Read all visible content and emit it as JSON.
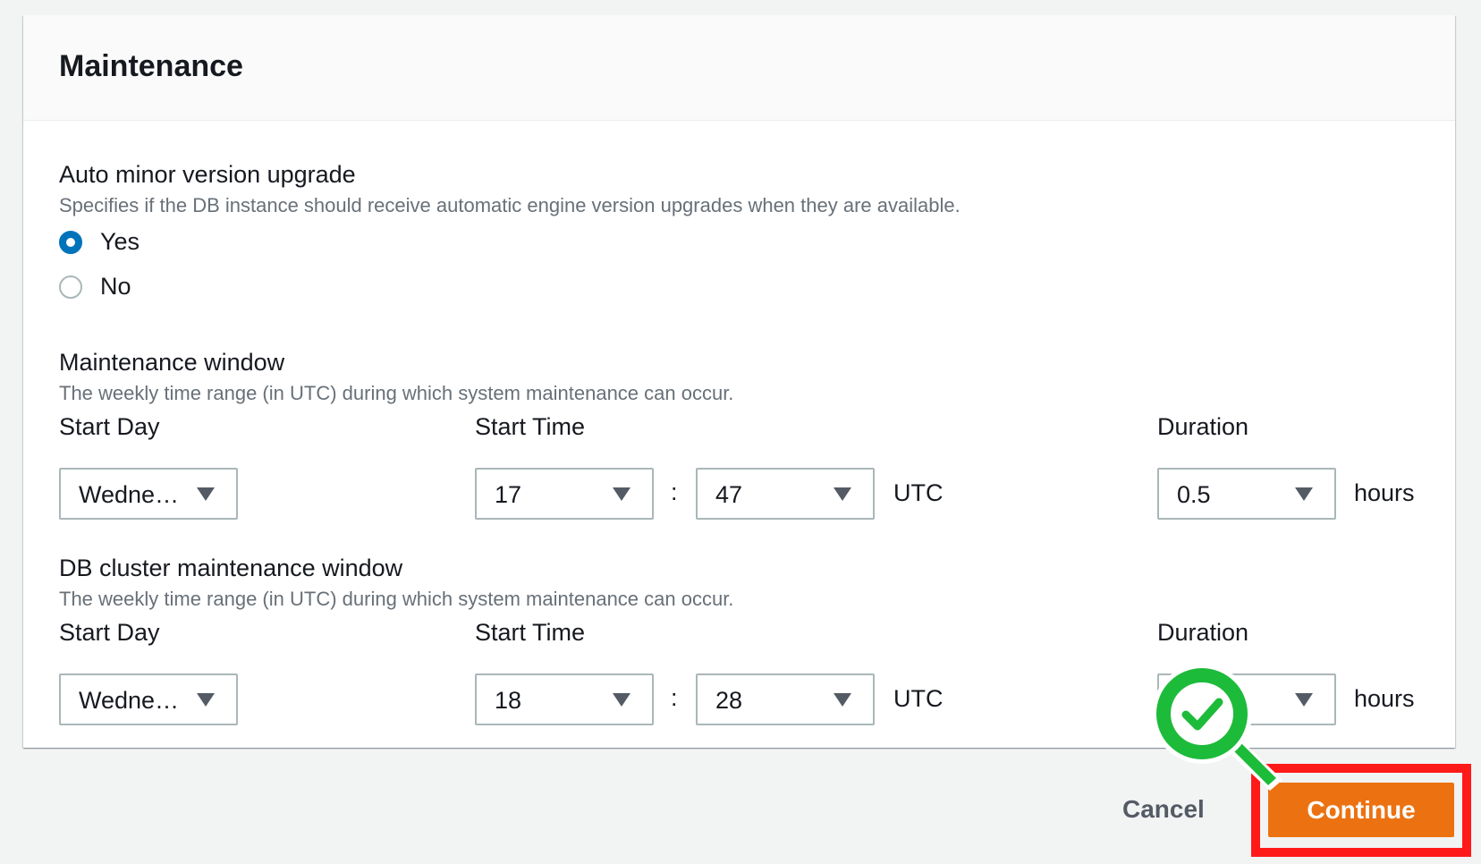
{
  "panel": {
    "title": "Maintenance"
  },
  "auto_minor": {
    "label": "Auto minor version upgrade",
    "description": "Specifies if the DB instance should receive automatic engine version upgrades when they are available.",
    "options": [
      {
        "label": "Yes",
        "selected": true
      },
      {
        "label": "No",
        "selected": false
      }
    ]
  },
  "maintenance_window": {
    "label": "Maintenance window",
    "description": "The weekly time range (in UTC) during which system maintenance can occur.",
    "start_day_label": "Start Day",
    "start_day_value": "Wedne…",
    "start_time_label": "Start Time",
    "hour_value": "17",
    "minute_value": "47",
    "separator": ":",
    "timezone": "UTC",
    "duration_label": "Duration",
    "duration_value": "0.5",
    "duration_unit": "hours"
  },
  "cluster_window": {
    "label": "DB cluster maintenance window",
    "description": "The weekly time range (in UTC) during which system maintenance can occur.",
    "start_day_label": "Start Day",
    "start_day_value": "Wedne…",
    "start_time_label": "Start Time",
    "hour_value": "18",
    "minute_value": "28",
    "separator": ":",
    "timezone": "UTC",
    "duration_label": "Duration",
    "duration_value": "",
    "duration_unit": "hours"
  },
  "footer": {
    "cancel_label": "Cancel",
    "continue_label": "Continue"
  },
  "colors": {
    "primary_button": "#ec7211",
    "radio_selected": "#0073bb",
    "highlight": "#ff1a1a",
    "marker_green": "#1dbb3a"
  },
  "icons": {
    "marker": "check-circle-icon",
    "select_caret": "caret-down-icon"
  }
}
